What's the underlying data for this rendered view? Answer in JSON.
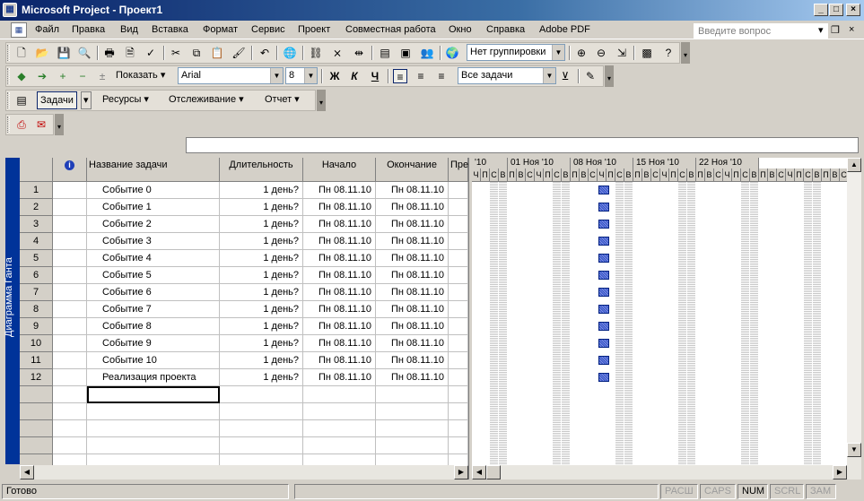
{
  "window": {
    "title": "Microsoft Project - Проект1",
    "app_icon": "ms-project-icon"
  },
  "menu": {
    "items": [
      "Файл",
      "Правка",
      "Вид",
      "Вставка",
      "Формат",
      "Сервис",
      "Проект",
      "Совместная работа",
      "Окно",
      "Справка",
      "Adobe PDF"
    ],
    "help_placeholder": "Введите вопрос"
  },
  "toolbar_standard": {
    "grouping": "Нет группировки"
  },
  "toolbar_format": {
    "show_label": "Показать",
    "font": "Arial",
    "size": "8",
    "bold": "Ж",
    "italic": "К",
    "underline": "Ч",
    "filter": "Все задачи"
  },
  "toolbar_project_guide": {
    "items": [
      "Задачи",
      "Ресурсы",
      "Отслеживание",
      "Отчет"
    ]
  },
  "sidebar": {
    "view_label": "Диаграмма Ганта"
  },
  "table": {
    "columns": {
      "info": "i",
      "name": "Название задачи",
      "duration": "Длительность",
      "start": "Начало",
      "finish": "Окончание",
      "pred": "Пре"
    },
    "rows": [
      {
        "id": "1",
        "name": "Событие 0",
        "duration": "1 день?",
        "start": "Пн 08.11.10",
        "finish": "Пн 08.11.10"
      },
      {
        "id": "2",
        "name": "Событие 1",
        "duration": "1 день?",
        "start": "Пн 08.11.10",
        "finish": "Пн 08.11.10"
      },
      {
        "id": "3",
        "name": "Событие 2",
        "duration": "1 день?",
        "start": "Пн 08.11.10",
        "finish": "Пн 08.11.10"
      },
      {
        "id": "4",
        "name": "Событие 3",
        "duration": "1 день?",
        "start": "Пн 08.11.10",
        "finish": "Пн 08.11.10"
      },
      {
        "id": "5",
        "name": "Событие 4",
        "duration": "1 день?",
        "start": "Пн 08.11.10",
        "finish": "Пн 08.11.10"
      },
      {
        "id": "6",
        "name": "Событие 5",
        "duration": "1 день?",
        "start": "Пн 08.11.10",
        "finish": "Пн 08.11.10"
      },
      {
        "id": "7",
        "name": "Событие 6",
        "duration": "1 день?",
        "start": "Пн 08.11.10",
        "finish": "Пн 08.11.10"
      },
      {
        "id": "8",
        "name": "Событие 7",
        "duration": "1 день?",
        "start": "Пн 08.11.10",
        "finish": "Пн 08.11.10"
      },
      {
        "id": "9",
        "name": "Событие 8",
        "duration": "1 день?",
        "start": "Пн 08.11.10",
        "finish": "Пн 08.11.10"
      },
      {
        "id": "10",
        "name": "Событие 9",
        "duration": "1 день?",
        "start": "Пн 08.11.10",
        "finish": "Пн 08.11.10"
      },
      {
        "id": "11",
        "name": "Событие 10",
        "duration": "1 день?",
        "start": "Пн 08.11.10",
        "finish": "Пн 08.11.10"
      },
      {
        "id": "12",
        "name": "Реализация проекта",
        "duration": "1 день?",
        "start": "Пн 08.11.10",
        "finish": "Пн 08.11.10"
      }
    ]
  },
  "gantt": {
    "weeks": [
      "'10",
      "01 Ноя '10",
      "08 Ноя '10",
      "15 Ноя '10",
      "22 Ноя '10"
    ],
    "days": [
      "Ч",
      "П",
      "С",
      "В",
      "П",
      "В",
      "С",
      "Ч",
      "П",
      "С",
      "В",
      "П",
      "В",
      "С",
      "Ч",
      "П",
      "С",
      "В",
      "П",
      "В",
      "С",
      "Ч",
      "П",
      "С",
      "В",
      "П",
      "В",
      "С",
      "Ч",
      "П",
      "С",
      "В",
      "П",
      "В",
      "С",
      "Ч",
      "П",
      "С",
      "В",
      "П",
      "В",
      "С"
    ]
  },
  "status": {
    "ready": "Готово",
    "indicators": [
      "РАСШ",
      "CAPS",
      "NUM",
      "SCRL",
      "ЗАМ"
    ]
  }
}
